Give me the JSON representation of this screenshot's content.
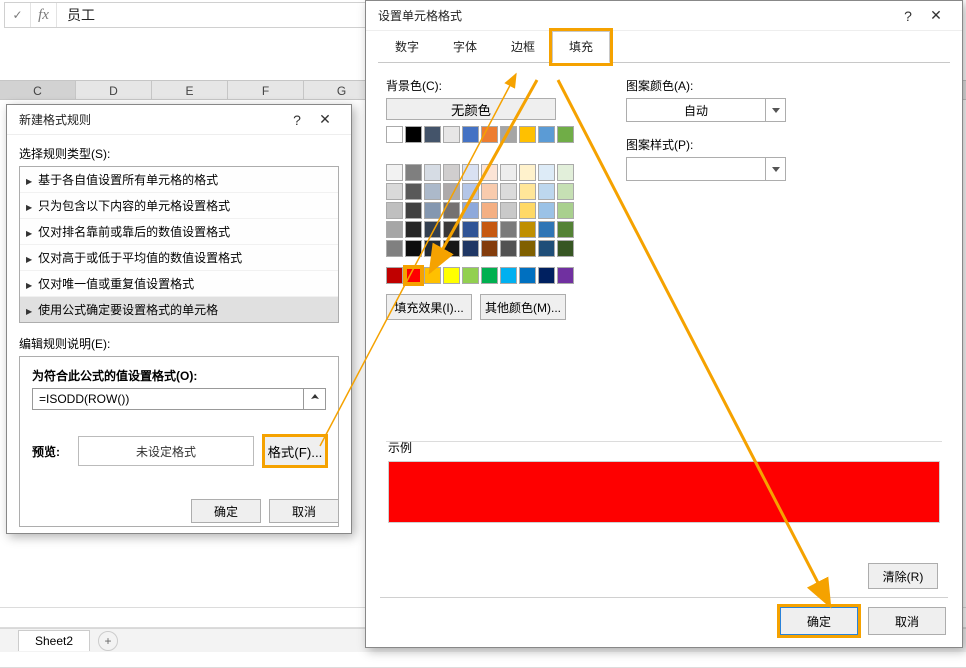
{
  "formula_bar": {
    "value": "员工"
  },
  "columns": [
    "C",
    "D",
    "E",
    "F",
    "G"
  ],
  "sheet_tab": "Sheet2",
  "rule_dialog": {
    "title": "新建格式规则",
    "select_type_label": "选择规则类型(S):",
    "rule_types": [
      "基于各自值设置所有单元格的格式",
      "只为包含以下内容的单元格设置格式",
      "仅对排名靠前或靠后的数值设置格式",
      "仅对高于或低于平均值的数值设置格式",
      "仅对唯一值或重复值设置格式",
      "使用公式确定要设置格式的单元格"
    ],
    "selected_rule_index": 5,
    "edit_label": "编辑规则说明(E):",
    "formula_label": "为符合此公式的值设置格式(O):",
    "formula_value": "=ISODD(ROW())",
    "preview_label": "预览:",
    "preview_text": "未设定格式",
    "format_btn": "格式(F)...",
    "ok": "确定",
    "cancel": "取消"
  },
  "format_dialog": {
    "title": "设置单元格格式",
    "tabs": [
      "数字",
      "字体",
      "边框",
      "填充"
    ],
    "active_tab_index": 3,
    "bg_label": "背景色(C):",
    "no_color": "无颜色",
    "pattern_color_label": "图案颜色(A):",
    "pattern_color_value": "自动",
    "pattern_style_label": "图案样式(P):",
    "fill_effects": "填充效果(I)...",
    "more_colors": "其他颜色(M)...",
    "example_label": "示例",
    "example_color": "#FE0000",
    "clear": "清除(R)",
    "ok": "确定",
    "cancel": "取消",
    "palette_row0": [
      "#FFFFFF",
      "#000000",
      "#44546A",
      "#E7E6E6",
      "#4472C4",
      "#ED7D31",
      "#A5A5A5",
      "#FFC000",
      "#5B9BD5",
      "#70AD47"
    ],
    "palette_themes": [
      [
        "#F2F2F2",
        "#7F7F7F",
        "#D6DCE4",
        "#D0CECE",
        "#D9E1F2",
        "#FCE4D6",
        "#EDEDED",
        "#FFF2CC",
        "#DDEBF7",
        "#E2EFDA"
      ],
      [
        "#D9D9D9",
        "#595959",
        "#ACB9CA",
        "#AEAAAA",
        "#B4C6E7",
        "#F8CBAD",
        "#DBDBDB",
        "#FFE699",
        "#BDD7EE",
        "#C6E0B4"
      ],
      [
        "#BFBFBF",
        "#404040",
        "#8497B0",
        "#757171",
        "#8EA9DB",
        "#F4B084",
        "#C9C9C9",
        "#FFD966",
        "#9BC2E6",
        "#A9D08E"
      ],
      [
        "#A6A6A6",
        "#262626",
        "#333F4F",
        "#3A3838",
        "#305496",
        "#C65911",
        "#7B7B7B",
        "#BF8F00",
        "#2F75B5",
        "#548235"
      ],
      [
        "#808080",
        "#0D0D0D",
        "#222B35",
        "#161616",
        "#203764",
        "#833C0C",
        "#525252",
        "#806000",
        "#1F4E78",
        "#375623"
      ]
    ],
    "palette_std": [
      "#C00000",
      "#FF0000",
      "#FFC000",
      "#FFFF00",
      "#92D050",
      "#00B050",
      "#00B0F0",
      "#0070C0",
      "#002060",
      "#7030A0"
    ],
    "selected_swatch_index": 1
  }
}
